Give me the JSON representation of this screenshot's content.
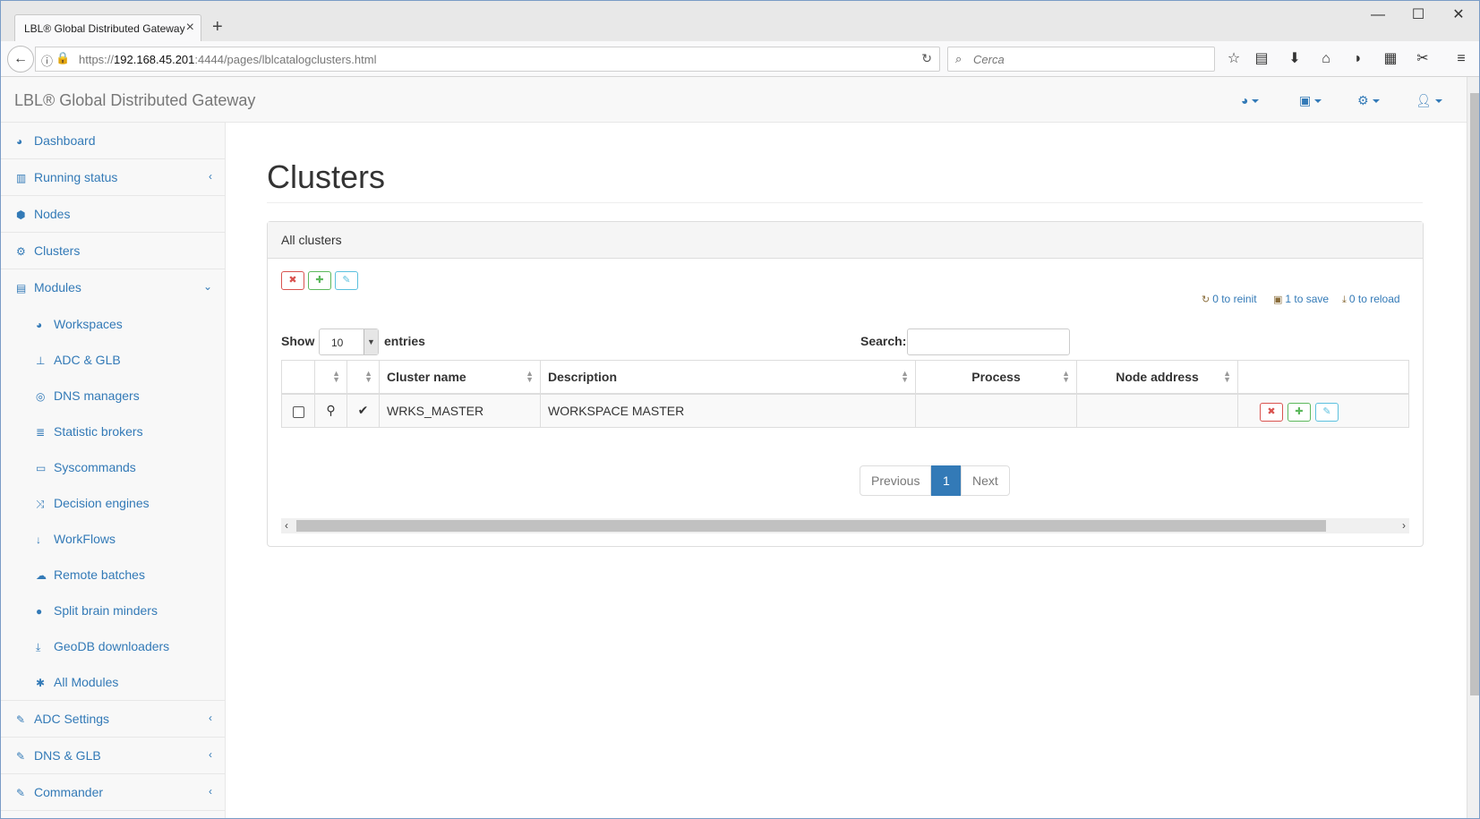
{
  "browser": {
    "tab_title": "LBL® Global Distributed Gateway",
    "url_prefix": "https://",
    "url_host": "192.168.45.201",
    "url_path": ":4444/pages/lblcatalogclusters.html",
    "search_placeholder": "Cerca"
  },
  "navbar": {
    "brand": "LBL® Global Distributed Gateway"
  },
  "sidebar": {
    "items": [
      {
        "label": "Dashboard"
      },
      {
        "label": "Running status"
      },
      {
        "label": "Nodes"
      },
      {
        "label": "Clusters"
      },
      {
        "label": "Modules"
      }
    ],
    "modules": [
      {
        "label": "Workspaces"
      },
      {
        "label": "ADC & GLB"
      },
      {
        "label": "DNS managers"
      },
      {
        "label": "Statistic brokers"
      },
      {
        "label": "Syscommands"
      },
      {
        "label": "Decision engines"
      },
      {
        "label": "WorkFlows"
      },
      {
        "label": "Remote batches"
      },
      {
        "label": "Split brain minders"
      },
      {
        "label": "GeoDB downloaders"
      },
      {
        "label": "All Modules"
      }
    ],
    "bottom": [
      {
        "label": "ADC Settings"
      },
      {
        "label": "DNS & GLB"
      },
      {
        "label": "Commander"
      }
    ]
  },
  "main": {
    "title": "Clusters",
    "panel_title": "All clusters",
    "status": {
      "reinit": "0 to reinit",
      "save": "1 to save",
      "reload": "0 to reload"
    },
    "length": {
      "show": "Show",
      "value": "10",
      "entries": "entries"
    },
    "search_label": "Search:",
    "columns": {
      "cluster_name": "Cluster name",
      "description": "Description",
      "process": "Process",
      "node_address": "Node address"
    },
    "rows": [
      {
        "cluster_name": "WRKS_MASTER",
        "description": "WORKSPACE MASTER",
        "process": "",
        "node_address": ""
      }
    ],
    "pagination": {
      "previous": "Previous",
      "current": "1",
      "next": "Next"
    }
  },
  "colors": {
    "link": "#337ab7",
    "danger": "#d9534f",
    "success": "#5cb85c",
    "info": "#5bc0de"
  }
}
